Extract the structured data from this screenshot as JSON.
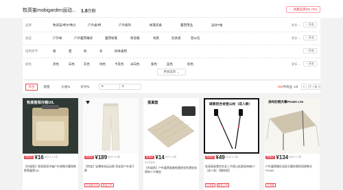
{
  "header": {
    "brand": "牧高笛mobigarden运动...",
    "score": "1.8",
    "score_unit": "万粉",
    "favorite_label": "收藏品牌(85,700)"
  },
  "filters": [
    {
      "label": "品牌",
      "options": [
        "牧高笛/希尔/牧头",
        "户外桌/椅",
        "户外服饰",
        "帐篷装备",
        "露营用品",
        "运动T恤"
      ],
      "more": "更多",
      "multi": "+ 多选"
    },
    {
      "label": "类型",
      "options": [
        "户外帐",
        "户外露营睡袋",
        "露营帐篷",
        "保温箱",
        "地席",
        "炊具组",
        "登山包"
      ],
      "more": "更多",
      "multi": "+ 多选"
    },
    {
      "label": "适用季节",
      "options": [
        "春",
        "夏",
        "秋",
        "冬",
        "四季通用"
      ],
      "more": "",
      "multi": "+ 多选"
    },
    {
      "label": "颜色",
      "options": [
        "黑色",
        "白色",
        "灰色",
        "绿色",
        "卡其色",
        "米白色",
        "紫色",
        "蓝色",
        "棕色"
      ],
      "more": "更多",
      "multi": "+ 多选"
    }
  ],
  "show_more": "更多选项",
  "sort": {
    "tabs": [
      "综合",
      "销量",
      "价格",
      "好评"
    ],
    "price_from": "¥",
    "price_to": "¥",
    "price_sep": "-",
    "result_count": "906",
    "result_suffix": "件商品",
    "page": "1/5",
    "prev": "<",
    "next": "下一页 >"
  },
  "products": [
    {
      "banner": "牧高笛保冷箱10L",
      "flag": "特卖价",
      "price": "¥16",
      "old_price": "¥39.9 4.1折",
      "note": "",
      "title": "【升级款】牧高笛保冷箱户外便携冷藏保鲜野营露营10L",
      "tags": []
    },
    {
      "banner": "",
      "flag": "特卖价",
      "price": "¥189",
      "old_price": "¥599 3.2折",
      "note": "",
      "title": "【特卖】轻薄休闲运动裤 男女款户外速干裤",
      "tags": [
        "已优惠40元",
        "新品上市"
      ]
    },
    {
      "banner": "蛋巢垫",
      "flag": "特卖价",
      "price": "¥14",
      "old_price": "¥99 1.4折",
      "note": "60天低价",
      "title": "【升级款】户外露营蛋巢帐篷地垫防潮垫加厚单人午睡垫",
      "tags": []
    },
    {
      "banner": "碳素铝合金登山杖（成人款）",
      "flag": "特卖价",
      "price": "¥49",
      "old_price": "¥149 3.3折",
      "note": "",
      "title": "牧高笛碳素铝合金三节登山杖超轻伸缩ZT（成人款）【赠软帆】",
      "tags": [
        "已优惠",
        "新品上市"
      ]
    },
    {
      "banner": "涤纶防晒天幕PO400 Lite",
      "flag": "特卖价",
      "price": "¥134",
      "old_price": "¥499 2.7折",
      "note": "",
      "title": "户外露营蝶形涤纶天幕防晒防雨便携式PO400",
      "tags": [
        "已优惠"
      ]
    }
  ],
  "colors": {
    "accent": "#e7464f"
  }
}
